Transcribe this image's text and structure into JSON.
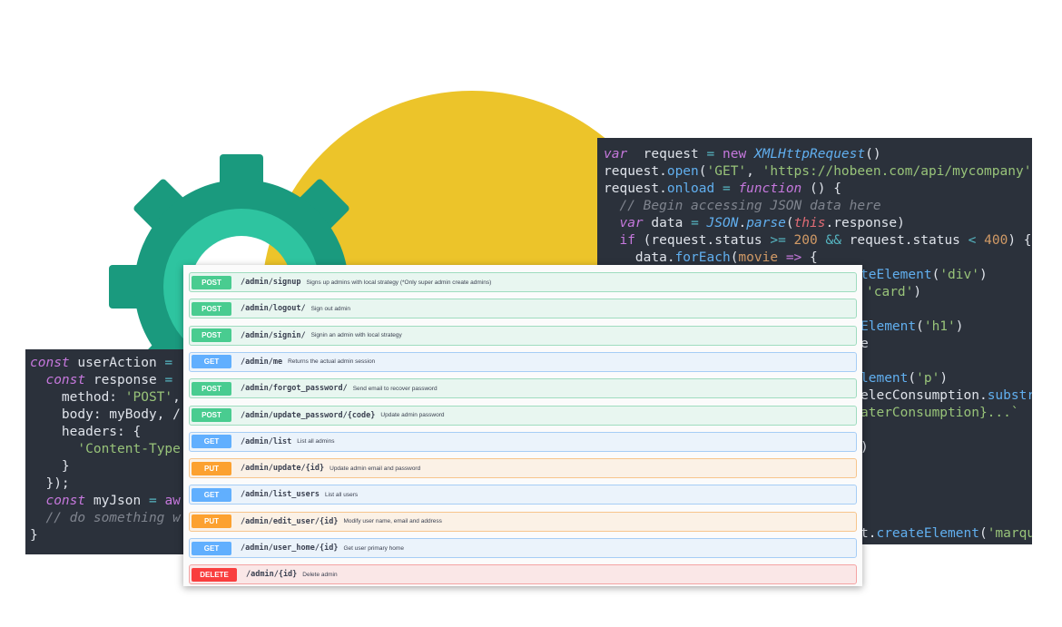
{
  "colors": {
    "circle": "#ecc42a",
    "gear_outer": "#1a9a7e",
    "gear_inner": "#2ec4a0",
    "code_bg": "#2b313b",
    "post": "#49cc90",
    "get": "#61affe",
    "put": "#fca130",
    "delete": "#f93e3e"
  },
  "icons": [
    "gear-icon"
  ],
  "right_code": [
    {
      "parts": [
        [
          "k",
          "var"
        ],
        [
          "",
          "  request "
        ],
        [
          "o",
          "="
        ],
        [
          "kw",
          " new "
        ],
        [
          "fi",
          "XMLHttpRequest"
        ],
        [
          "",
          "()"
        ]
      ]
    },
    {
      "parts": [
        [
          "",
          "request."
        ],
        [
          "f",
          "open"
        ],
        [
          "",
          "("
        ],
        [
          "s",
          "'GET'"
        ],
        [
          "",
          ", "
        ],
        [
          "s",
          "'https://hobeen.com/api/mycompany'"
        ]
      ]
    },
    {
      "parts": [
        [
          "",
          "request."
        ],
        [
          "f",
          "onload"
        ],
        [
          "",
          " "
        ],
        [
          "o",
          "="
        ],
        [
          "",
          " "
        ],
        [
          "k",
          "function"
        ],
        [
          "",
          " () {"
        ]
      ]
    },
    {
      "parts": [
        [
          "",
          "  "
        ],
        [
          "c",
          "// Begin accessing JSON data here"
        ]
      ]
    },
    {
      "parts": [
        [
          "",
          "  "
        ],
        [
          "k",
          "var"
        ],
        [
          "",
          " data "
        ],
        [
          "o",
          "="
        ],
        [
          "",
          " "
        ],
        [
          "fi",
          "JSON"
        ],
        [
          "",
          "."
        ],
        [
          "fi",
          "parse"
        ],
        [
          "",
          "("
        ],
        [
          "t",
          "this"
        ],
        [
          "",
          ".response)"
        ]
      ]
    },
    {
      "parts": [
        [
          "",
          "  "
        ],
        [
          "kw",
          "if"
        ],
        [
          "",
          " (request.status "
        ],
        [
          "o",
          ">="
        ],
        [
          "",
          " "
        ],
        [
          "n",
          "200"
        ],
        [
          "",
          " "
        ],
        [
          "o",
          "&&"
        ],
        [
          "",
          " request.status "
        ],
        [
          "o",
          "<"
        ],
        [
          "",
          " "
        ],
        [
          "n",
          "400"
        ],
        [
          "",
          ") {"
        ]
      ]
    },
    {
      "parts": [
        [
          "",
          "    data."
        ],
        [
          "f",
          "forEach"
        ],
        [
          "",
          "("
        ],
        [
          "n",
          "movie"
        ],
        [
          "",
          " "
        ],
        [
          "kw",
          "=>"
        ],
        [
          "",
          " {"
        ]
      ]
    }
  ],
  "right_fragments": [
    {
      "line": 8,
      "parts": [
        [
          "f",
          "teElement"
        ],
        [
          "",
          "("
        ],
        [
          "s",
          "'div'"
        ],
        [
          "",
          ")"
        ]
      ]
    },
    {
      "line": 9,
      "parts": [
        [
          "s",
          "'card'"
        ],
        [
          "",
          ")"
        ]
      ]
    },
    {
      "line": 11,
      "parts": [
        [
          "f",
          "Element"
        ],
        [
          "",
          "("
        ],
        [
          "s",
          "'h1'"
        ],
        [
          "",
          ")"
        ]
      ]
    },
    {
      "line": 12,
      "parts": [
        [
          "",
          "e"
        ]
      ]
    },
    {
      "line": 14,
      "parts": [
        [
          "f",
          "lement"
        ],
        [
          "",
          "("
        ],
        [
          "s",
          "'p'"
        ],
        [
          "",
          ")"
        ]
      ]
    },
    {
      "line": 15,
      "parts": [
        [
          "",
          "elecConsumption."
        ],
        [
          "f",
          "substr"
        ]
      ]
    },
    {
      "line": 16,
      "parts": [
        [
          "s",
          "aterConsumption}...`"
        ]
      ]
    },
    {
      "line": 18,
      "parts": [
        [
          "",
          ")"
        ]
      ]
    },
    {
      "line": 23,
      "parts": [
        [
          "",
          "t."
        ],
        [
          "f",
          "createElement"
        ],
        [
          "",
          "("
        ],
        [
          "s",
          "'marqu"
        ]
      ]
    }
  ],
  "left_code": [
    {
      "parts": [
        [
          "k",
          "const"
        ],
        [
          "",
          " userAction "
        ],
        [
          "o",
          "="
        ],
        [
          "",
          " "
        ]
      ]
    },
    {
      "parts": [
        [
          "",
          "  "
        ],
        [
          "k",
          "const"
        ],
        [
          "",
          " response "
        ],
        [
          "o",
          "="
        ]
      ]
    },
    {
      "parts": [
        [
          "",
          "    method: "
        ],
        [
          "s",
          "'POST'"
        ],
        [
          "",
          ","
        ]
      ]
    },
    {
      "parts": [
        [
          "",
          "    body: myBody, /"
        ]
      ]
    },
    {
      "parts": [
        [
          "",
          "    headers: {"
        ]
      ]
    },
    {
      "parts": [
        [
          "",
          "      "
        ],
        [
          "s",
          "'Content-Type"
        ]
      ]
    },
    {
      "parts": [
        [
          "",
          "    }"
        ]
      ]
    },
    {
      "parts": [
        [
          "",
          "  });"
        ]
      ]
    },
    {
      "parts": [
        [
          "",
          "  "
        ],
        [
          "k",
          "const"
        ],
        [
          "",
          " myJson "
        ],
        [
          "o",
          "="
        ],
        [
          "",
          " "
        ],
        [
          "kw",
          "aw"
        ]
      ]
    },
    {
      "parts": [
        [
          "",
          "  "
        ],
        [
          "c",
          "// do something w"
        ]
      ]
    },
    {
      "parts": [
        [
          "",
          "}"
        ]
      ]
    }
  ],
  "endpoints": [
    {
      "method": "POST",
      "path": "/admin/signup",
      "desc": "Signs up admins with local strategy (*Only super admin create admins)"
    },
    {
      "method": "POST",
      "path": "/admin/logout/",
      "desc": "Sign out admin"
    },
    {
      "method": "POST",
      "path": "/admin/signin/",
      "desc": "Signin an admin with local strategy"
    },
    {
      "method": "GET",
      "path": "/admin/me",
      "desc": "Returns the actual admin session"
    },
    {
      "method": "POST",
      "path": "/admin/forgot_password/",
      "desc": "Send email to recover password"
    },
    {
      "method": "POST",
      "path": "/admin/update_password/{code}",
      "desc": "Update admin password"
    },
    {
      "method": "GET",
      "path": "/admin/list",
      "desc": "List all admins"
    },
    {
      "method": "PUT",
      "path": "/admin/update/{id}",
      "desc": "Update admin email and password"
    },
    {
      "method": "GET",
      "path": "/admin/list_users",
      "desc": "List all users"
    },
    {
      "method": "PUT",
      "path": "/admin/edit_user/{id}",
      "desc": "Modify user name, email and address"
    },
    {
      "method": "GET",
      "path": "/admin/user_home/{id}",
      "desc": "Get user primary home"
    },
    {
      "method": "DELETE",
      "path": "/admin/{id}",
      "desc": "Delete admin"
    }
  ]
}
